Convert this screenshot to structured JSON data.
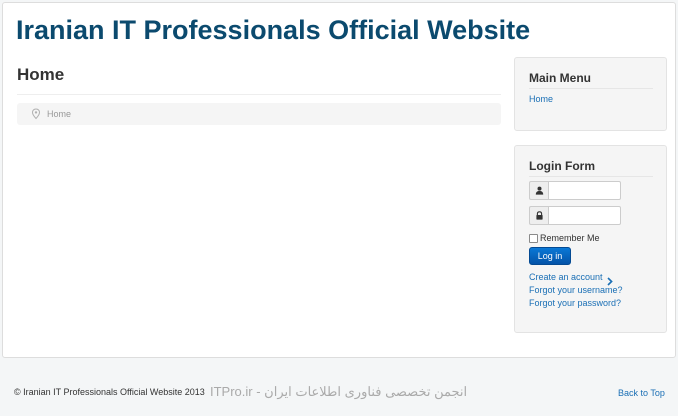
{
  "site": {
    "title": "Iranian IT Professionals Official Website"
  },
  "main": {
    "heading": "Home",
    "breadcrumb": {
      "items": [
        "Home"
      ]
    }
  },
  "main_menu": {
    "title": "Main Menu",
    "items": [
      {
        "label": "Home"
      }
    ]
  },
  "login_form": {
    "title": "Login Form",
    "username": {
      "value": "",
      "placeholder": "",
      "icon": "user-icon"
    },
    "password": {
      "value": "",
      "placeholder": "",
      "icon": "lock-icon"
    },
    "remember_label": "Remember Me",
    "remember_checked": false,
    "login_button": "Log in",
    "create_account": "Create an account",
    "forgot_username": "Forgot your username?",
    "forgot_password": "Forgot your password?"
  },
  "footer": {
    "copyright": "© Iranian IT Professionals Official Website 2013",
    "watermark": "ITPro.ir - انجمن تخصصی فناوری اطلاعات ایران",
    "back_to_top": "Back to Top"
  },
  "colors": {
    "title": "#0b4a6e",
    "link": "#1a6fb5",
    "button": "#0a78d6",
    "panel": "#f5f5f5"
  }
}
